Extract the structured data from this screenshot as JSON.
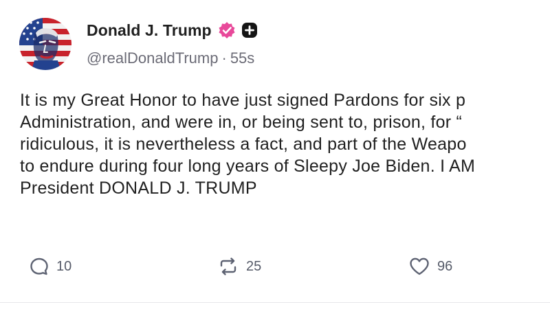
{
  "author": {
    "display_name": "Donald J. Trump",
    "handle": "@realDonaldTrump",
    "separator": "·",
    "time": "55s",
    "avatar_icon": "flag-portrait-avatar",
    "verified_icon": "verified-badge-icon",
    "verified_color": "#e8499a",
    "plus_icon": "plus-icon"
  },
  "post": {
    "lines": [
      "It is my Great Honor to have just signed Pardons for six p",
      "Administration, and were in, or being sent to, prison, for “",
      "ridiculous, it is nevertheless a fact, and part of the Weapo",
      "to endure during four long years of Sleepy Joe Biden. I AM",
      "President DONALD J. TRUMP"
    ]
  },
  "actions": {
    "reply": {
      "icon": "reply-icon",
      "count": "10"
    },
    "repost": {
      "icon": "repost-icon",
      "count": "25"
    },
    "like": {
      "icon": "heart-icon",
      "count": "96"
    }
  }
}
